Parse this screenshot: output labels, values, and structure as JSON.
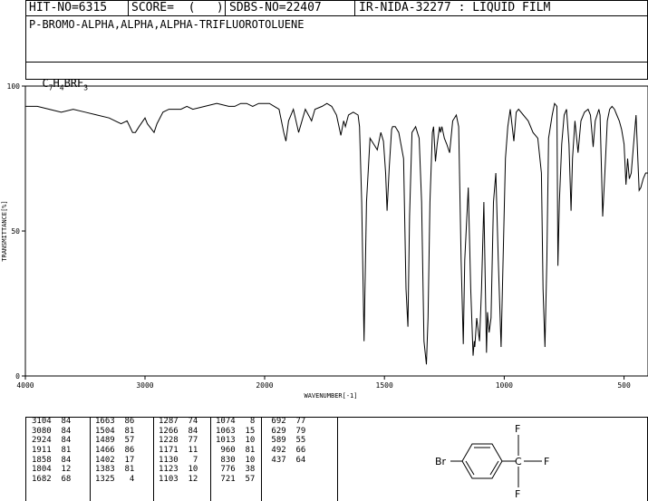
{
  "header": {
    "hit_no": "HIT-NO=6315",
    "score": "SCORE=  (   )",
    "sdbs_no": "SDBS-NO=22407",
    "ir": "IR-NIDA-32277 : LIQUID FILM",
    "compound": "P-BROMO-ALPHA,ALPHA,ALPHA-TRIFLUOROTOLUENE",
    "formula_parts": [
      "C",
      "7",
      "H",
      "4",
      "BRF",
      "3"
    ]
  },
  "chart_data": {
    "type": "line",
    "xlabel": "WAVENUMBER[-1]",
    "ylabel": "TRANSMITTANCE[%]",
    "xlim": [
      4000,
      400
    ],
    "ylim": [
      0,
      100
    ],
    "x_ticks": [
      4000,
      3000,
      2000,
      1500,
      1000,
      500
    ],
    "y_ticks": [
      0,
      50,
      100
    ],
    "series": [
      {
        "x": [
          4000,
          3900,
          3800,
          3700,
          3600,
          3500,
          3400,
          3300,
          3250,
          3200,
          3150,
          3104,
          3080,
          3050,
          3000,
          2980,
          2924,
          2900,
          2850,
          2800,
          2750,
          2700,
          2650,
          2600,
          2500,
          2400,
          2300,
          2250,
          2200,
          2150,
          2100,
          2050,
          2000,
          1980,
          1960,
          1940,
          1920,
          1911,
          1900,
          1880,
          1858,
          1830,
          1804,
          1790,
          1760,
          1740,
          1720,
          1700,
          1682,
          1670,
          1663,
          1650,
          1630,
          1610,
          1604,
          1595,
          1585,
          1575,
          1560,
          1545,
          1530,
          1515,
          1504,
          1495,
          1489,
          1480,
          1470,
          1466,
          1455,
          1440,
          1420,
          1410,
          1402,
          1395,
          1385,
          1370,
          1355,
          1345,
          1335,
          1325,
          1318,
          1310,
          1300,
          1295,
          1287,
          1280,
          1270,
          1266,
          1260,
          1250,
          1240,
          1228,
          1215,
          1200,
          1190,
          1180,
          1171,
          1165,
          1150,
          1140,
          1130,
          1125,
          1123,
          1115,
          1103,
          1095,
          1085,
          1074,
          1070,
          1063,
          1055,
          1045,
          1035,
          1025,
          1013,
          1005,
          995,
          985,
          975,
          960,
          950,
          940,
          920,
          900,
          880,
          860,
          845,
          838,
          830,
          822,
          815,
          800,
          790,
          780,
          776,
          770,
          760,
          750,
          740,
          730,
          721,
          715,
          705,
          692,
          680,
          665,
          650,
          640,
          629,
          620,
          605,
          600,
          589,
          580,
          570,
          560,
          550,
          540,
          530,
          520,
          510,
          500,
          492,
          485,
          478,
          470,
          460,
          450,
          437,
          430,
          420,
          410,
          400
        ],
        "y": [
          93,
          93,
          92,
          91,
          92,
          91,
          90,
          89,
          88,
          87,
          88,
          84,
          84,
          86,
          89,
          87,
          84,
          87,
          91,
          92,
          92,
          92,
          93,
          92,
          93,
          94,
          93,
          93,
          94,
          94,
          93,
          94,
          94,
          94,
          93,
          92,
          84,
          81,
          88,
          92,
          84,
          92,
          88,
          92,
          93,
          94,
          93,
          90,
          83,
          88,
          86,
          90,
          91,
          90,
          86,
          60,
          12,
          60,
          82,
          80,
          78,
          84,
          81,
          70,
          57,
          72,
          85,
          86,
          86,
          84,
          75,
          30,
          17,
          55,
          84,
          86,
          82,
          60,
          12,
          4,
          20,
          60,
          84,
          86,
          74,
          80,
          86,
          84,
          86,
          82,
          80,
          77,
          88,
          90,
          86,
          40,
          11,
          40,
          65,
          30,
          7,
          12,
          10,
          20,
          12,
          30,
          60,
          8,
          22,
          15,
          20,
          60,
          70,
          40,
          10,
          40,
          75,
          86,
          92,
          81,
          91,
          92,
          90,
          88,
          84,
          82,
          70,
          30,
          10,
          40,
          82,
          90,
          94,
          93,
          38,
          60,
          80,
          90,
          92,
          80,
          57,
          75,
          88,
          77,
          88,
          91,
          92,
          90,
          79,
          88,
          92,
          90,
          55,
          70,
          88,
          92,
          93,
          92,
          90,
          88,
          85,
          80,
          66,
          75,
          68,
          70,
          80,
          90,
          64,
          65,
          68,
          70,
          70
        ]
      }
    ]
  },
  "peak_columns": [
    [
      [
        "3104",
        "84"
      ],
      [
        "3080",
        "84"
      ],
      [
        "2924",
        "84"
      ],
      [
        "1911",
        "81"
      ],
      [
        "1858",
        "84"
      ],
      [
        "1804",
        "12"
      ],
      [
        "1682",
        "68"
      ]
    ],
    [
      [
        "1663",
        "86"
      ],
      [
        "1504",
        "81"
      ],
      [
        "1489",
        "57"
      ],
      [
        "1466",
        "86"
      ],
      [
        "1402",
        "17"
      ],
      [
        "1383",
        "81"
      ],
      [
        "1325",
        "4"
      ]
    ],
    [
      [
        "1287",
        "74"
      ],
      [
        "1266",
        "84"
      ],
      [
        "1228",
        "77"
      ],
      [
        "1171",
        "11"
      ],
      [
        "1130",
        "7"
      ],
      [
        "1123",
        "10"
      ],
      [
        "1103",
        "12"
      ]
    ],
    [
      [
        "1074",
        "8"
      ],
      [
        "1063",
        "15"
      ],
      [
        "1013",
        "10"
      ],
      [
        "960",
        "81"
      ],
      [
        "830",
        "10"
      ],
      [
        "776",
        "38"
      ],
      [
        "721",
        "57"
      ]
    ],
    [
      [
        "692",
        "77"
      ],
      [
        "629",
        "79"
      ],
      [
        "589",
        "55"
      ],
      [
        "492",
        "66"
      ],
      [
        "437",
        "64"
      ]
    ]
  ],
  "structure": {
    "labels": {
      "br": "Br",
      "c": "C",
      "f_top": "F",
      "f_right": "F",
      "f_bottom": "F"
    }
  }
}
